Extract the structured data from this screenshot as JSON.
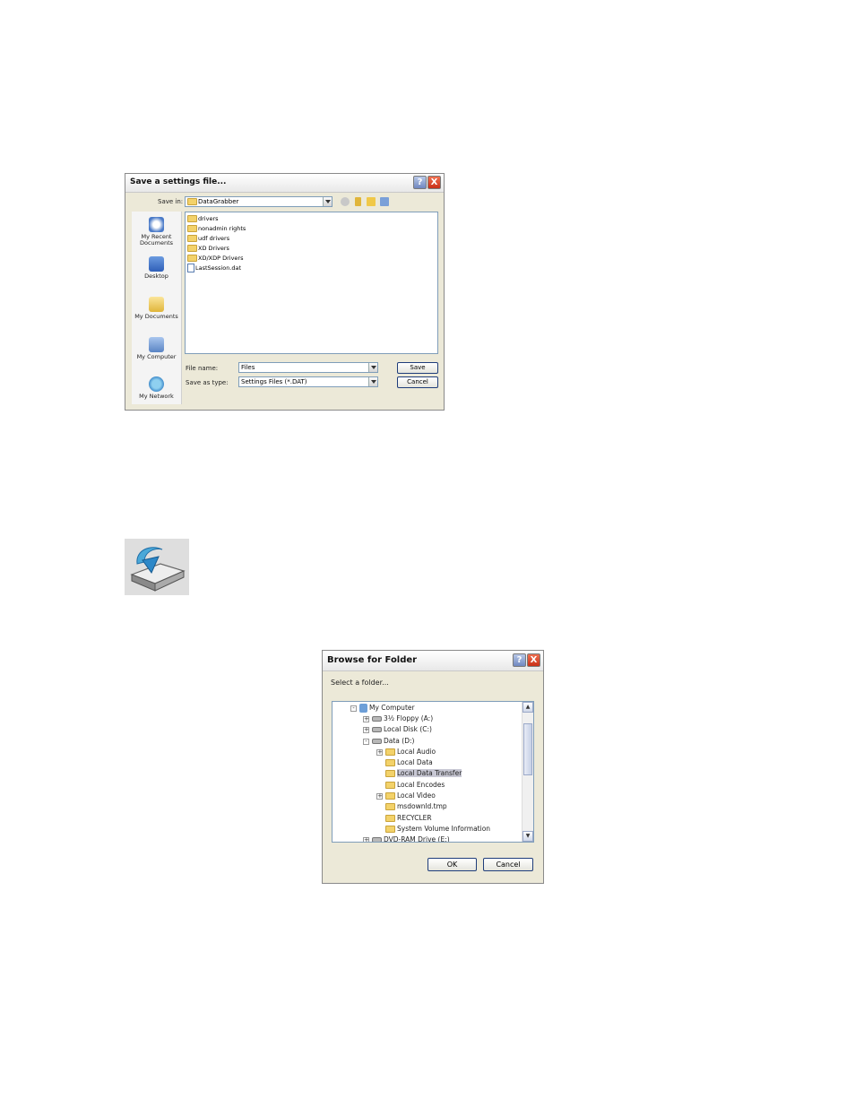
{
  "save_dialog": {
    "title": "Save a settings file...",
    "help_label": "?",
    "close_label": "X",
    "save_in_label": "Save in:",
    "save_in_value": "DataGrabber",
    "places": [
      {
        "label": "My Recent Documents",
        "icon": "recent-documents-icon"
      },
      {
        "label": "Desktop",
        "icon": "desktop-icon"
      },
      {
        "label": "My Documents",
        "icon": "my-documents-icon"
      },
      {
        "label": "My Computer",
        "icon": "my-computer-icon"
      },
      {
        "label": "My Network",
        "icon": "my-network-icon"
      }
    ],
    "files": [
      {
        "name": "drivers",
        "type": "folder"
      },
      {
        "name": "nonadmin rights",
        "type": "folder"
      },
      {
        "name": "udf drivers",
        "type": "folder"
      },
      {
        "name": "XD Drivers",
        "type": "folder"
      },
      {
        "name": "XD/XDP Drivers",
        "type": "folder"
      },
      {
        "name": "LastSession.dat",
        "type": "file"
      }
    ],
    "file_name_label": "File name:",
    "file_name_value": "Files",
    "save_as_type_label": "Save as type:",
    "save_as_type_value": "Settings Files (*.DAT)",
    "save_button": "Save",
    "cancel_button": "Cancel"
  },
  "browse_dialog": {
    "title": "Browse for Folder",
    "help_label": "?",
    "close_label": "X",
    "prompt": "Select a folder...",
    "tree": [
      {
        "label": "My Computer",
        "expander": "-"
      },
      {
        "label": "3½ Floppy (A:)",
        "expander": "+"
      },
      {
        "label": "Local Disk (C:)",
        "expander": "+"
      },
      {
        "label": "Data (D:)",
        "expander": "-"
      },
      {
        "label": "Local Audio",
        "expander": "+"
      },
      {
        "label": "Local Data",
        "expander": ""
      },
      {
        "label": "Local Data Transfer",
        "expander": "",
        "selected": true
      },
      {
        "label": "Local Encodes",
        "expander": ""
      },
      {
        "label": "Local Video",
        "expander": "+"
      },
      {
        "label": "msdownld.tmp",
        "expander": ""
      },
      {
        "label": "RECYCLER",
        "expander": ""
      },
      {
        "label": "System Volume Information",
        "expander": ""
      },
      {
        "label": "DVD-RAM Drive (E:)",
        "expander": "+"
      }
    ],
    "ok_button": "OK",
    "cancel_button": "Cancel"
  },
  "disk_icon": {
    "icon": "disk-restore-icon"
  }
}
